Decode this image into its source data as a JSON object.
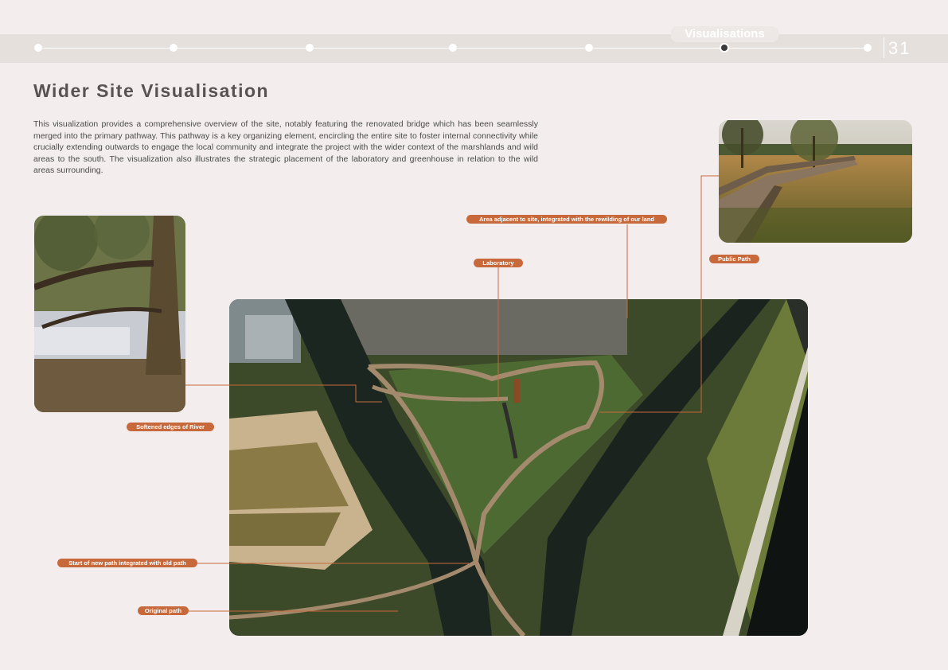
{
  "header": {
    "section_label": "Visualisations",
    "page_number": "31",
    "timeline_steps": 7,
    "active_step_index": 5
  },
  "title": "Wider Site Visualisation",
  "intro_text": "This visualization provides a comprehensive overview of the site, notably featuring the renovated bridge which has been seamlessly merged into the primary pathway. This pathway is a key organizing element, encircling the entire site to foster internal connectivity while crucially extending outwards to engage the local community and integrate the project with the wider context of the marshlands and wild areas to the south. The visualization also illustrates the strategic placement of the laboratory and greenhouse in relation to the wild areas surrounding.",
  "annotations": {
    "area_adjacent": "Area adjacent to site, integrated with the rewilding of our land",
    "laboratory": "Laboratory",
    "public_path": "Public Path",
    "softened_edges": "Softened edges of River",
    "start_new_path": "Start of new path integrated with old path",
    "original_path": "Original path"
  },
  "colors": {
    "accent": "#c8693b",
    "background": "#f3eeed",
    "title": "#575352"
  }
}
